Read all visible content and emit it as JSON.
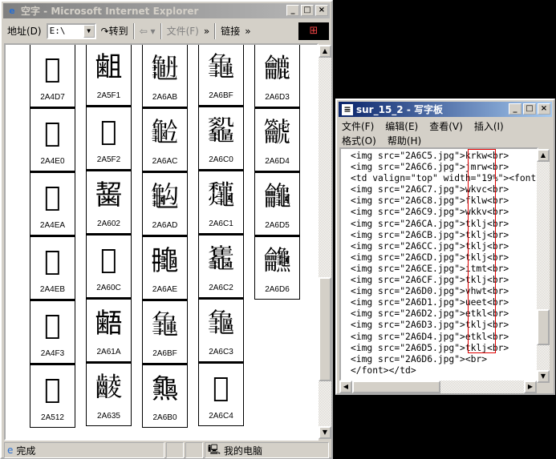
{
  "ie": {
    "title": "空字 - Microsoft Internet Explorer",
    "address_label": "地址(D)",
    "address_value": "E:\\",
    "go_label": "转到",
    "back_icon": "back-arrow-icon",
    "file_menu": "文件(F)",
    "more": "»",
    "links_label": "链接",
    "more2": "»",
    "status_text": "完成",
    "zone_text": "我的电脑",
    "columns": [
      [
        {
          "g": "𪓗",
          "c": "2A4D7"
        },
        {
          "g": "𪓠",
          "c": "2A4E0"
        },
        {
          "g": "𪓪",
          "c": "2A4EA"
        },
        {
          "g": "𪓫",
          "c": "2A4EB"
        },
        {
          "g": "𪓳",
          "c": "2A4F3"
        },
        {
          "g": "𪔒",
          "c": "2A512"
        }
      ],
      [
        {
          "g": "𪗱",
          "c": "2A5F1"
        },
        {
          "g": "𪗲",
          "c": "2A5F2"
        },
        {
          "g": "𪘂",
          "c": "2A602"
        },
        {
          "g": "𪘌",
          "c": "2A60C"
        },
        {
          "g": "𪘚",
          "c": "2A61A"
        },
        {
          "g": "𪘵",
          "c": "2A635"
        }
      ],
      [
        {
          "g": "𪚫",
          "c": "2A6AB"
        },
        {
          "g": "𪚬",
          "c": "2A6AC"
        },
        {
          "g": "𪚭",
          "c": "2A6AD"
        },
        {
          "g": "𪚮",
          "c": "2A6AE"
        },
        {
          "g": "𪚿",
          "c": "2A6BF"
        },
        {
          "g": "𪚰",
          "c": "2A6B0"
        }
      ],
      [
        {
          "g": "𪚿",
          "c": "2A6BF"
        },
        {
          "g": "𪛀",
          "c": "2A6C0"
        },
        {
          "g": "𪛁",
          "c": "2A6C1"
        },
        {
          "g": "𪛂",
          "c": "2A6C2"
        },
        {
          "g": "𪛃",
          "c": "2A6C3"
        },
        {
          "g": "𪛄",
          "c": "2A6C4"
        }
      ],
      [
        {
          "g": "𪛓",
          "c": "2A6D3"
        },
        {
          "g": "𪛔",
          "c": "2A6D4"
        },
        {
          "g": "𪛕",
          "c": "2A6D5"
        },
        {
          "g": "𪛖",
          "c": "2A6D6"
        }
      ]
    ]
  },
  "wordpad": {
    "title": "sur_15_2 - 写字板",
    "menu": [
      "文件(F)",
      "编辑(E)",
      "查看(V)",
      "插入(I)"
    ],
    "menu2": [
      "格式(O)",
      "帮助(H)"
    ],
    "lines": [
      "<img src=\"2A6C5.jpg\">krkw<br>",
      "<img src=\"2A6C6.jpg\">jmrw<br>",
      "<td valign=\"top\" width=\"19%\"><font",
      "<img src=\"2A6C7.jpg\">wkvc<br>",
      "<img src=\"2A6C8.jpg\">fklw<br>",
      "<img src=\"2A6C9.jpg\">wkkv<br>",
      "<img src=\"2A6CA.jpg\">tklj<br>",
      "<img src=\"2A6CB.jpg\">tklj<br>",
      "<img src=\"2A6CC.jpg\">tklj<br>",
      "<img src=\"2A6CD.jpg\">tklj<br>",
      "<img src=\"2A6CE.jpg\">itmt<br>",
      "<img src=\"2A6CF.jpg\">tklj<br>",
      "<img src=\"2A6D0.jpg\">vhwt<br>",
      "<img src=\"2A6D1.jpg\">ueet<br>",
      "<img src=\"2A6D2.jpg\">etkl<br>",
      "<img src=\"2A6D3.jpg\">tklj<br>",
      "<img src=\"2A6D4.jpg\">etkl<br>",
      "<img src=\"2A6D5.jpg\">tklj<br>",
      "<img src=\"2A6D6.jpg\"><br>",
      "</font></td>"
    ],
    "highlight_color": "#e00000"
  }
}
